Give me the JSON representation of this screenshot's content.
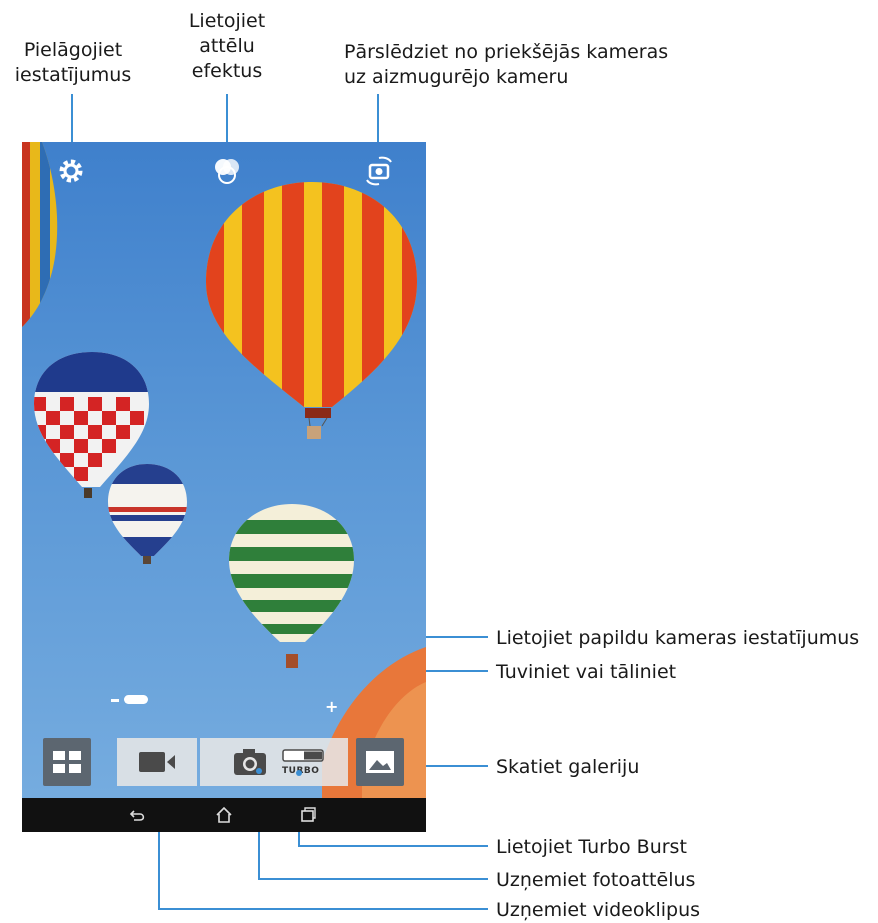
{
  "callouts": {
    "settings": "Pielāgojiet\niestatījumus",
    "effects": "Lietojiet\nattēlu\nefektus",
    "switch_camera": "Pārslēdziet no priekšējās kameras\nuz aizmugurējo kameru",
    "advanced_settings": "Lietojiet papildu kameras iestatījumus",
    "zoom": "Tuviniet vai tāliniet",
    "gallery": "Skatiet galeriju",
    "turbo_burst": "Lietojiet Turbo Burst",
    "take_photos": "Uzņemiet fotoattēlus",
    "record_video": "Uzņemiet videoklipus"
  },
  "camera_ui": {
    "zoom_minus": "–",
    "zoom_plus": "+",
    "turbo_label": "TURBO",
    "icons": {
      "settings": "gear-icon",
      "effects": "effects-icon",
      "switch": "camera-switch-icon",
      "advanced": "grid-icon",
      "video": "video-camera-icon",
      "photo": "camera-icon",
      "turbo_toggle": "toggle-icon",
      "gallery": "image-icon",
      "back": "back-icon",
      "home": "home-icon",
      "recent": "recent-apps-icon"
    }
  },
  "colors": {
    "callout_line": "#3b8fd4",
    "sky": "#4a88d0",
    "button_dark": "#5c6670",
    "nav_bar": "#111111"
  }
}
